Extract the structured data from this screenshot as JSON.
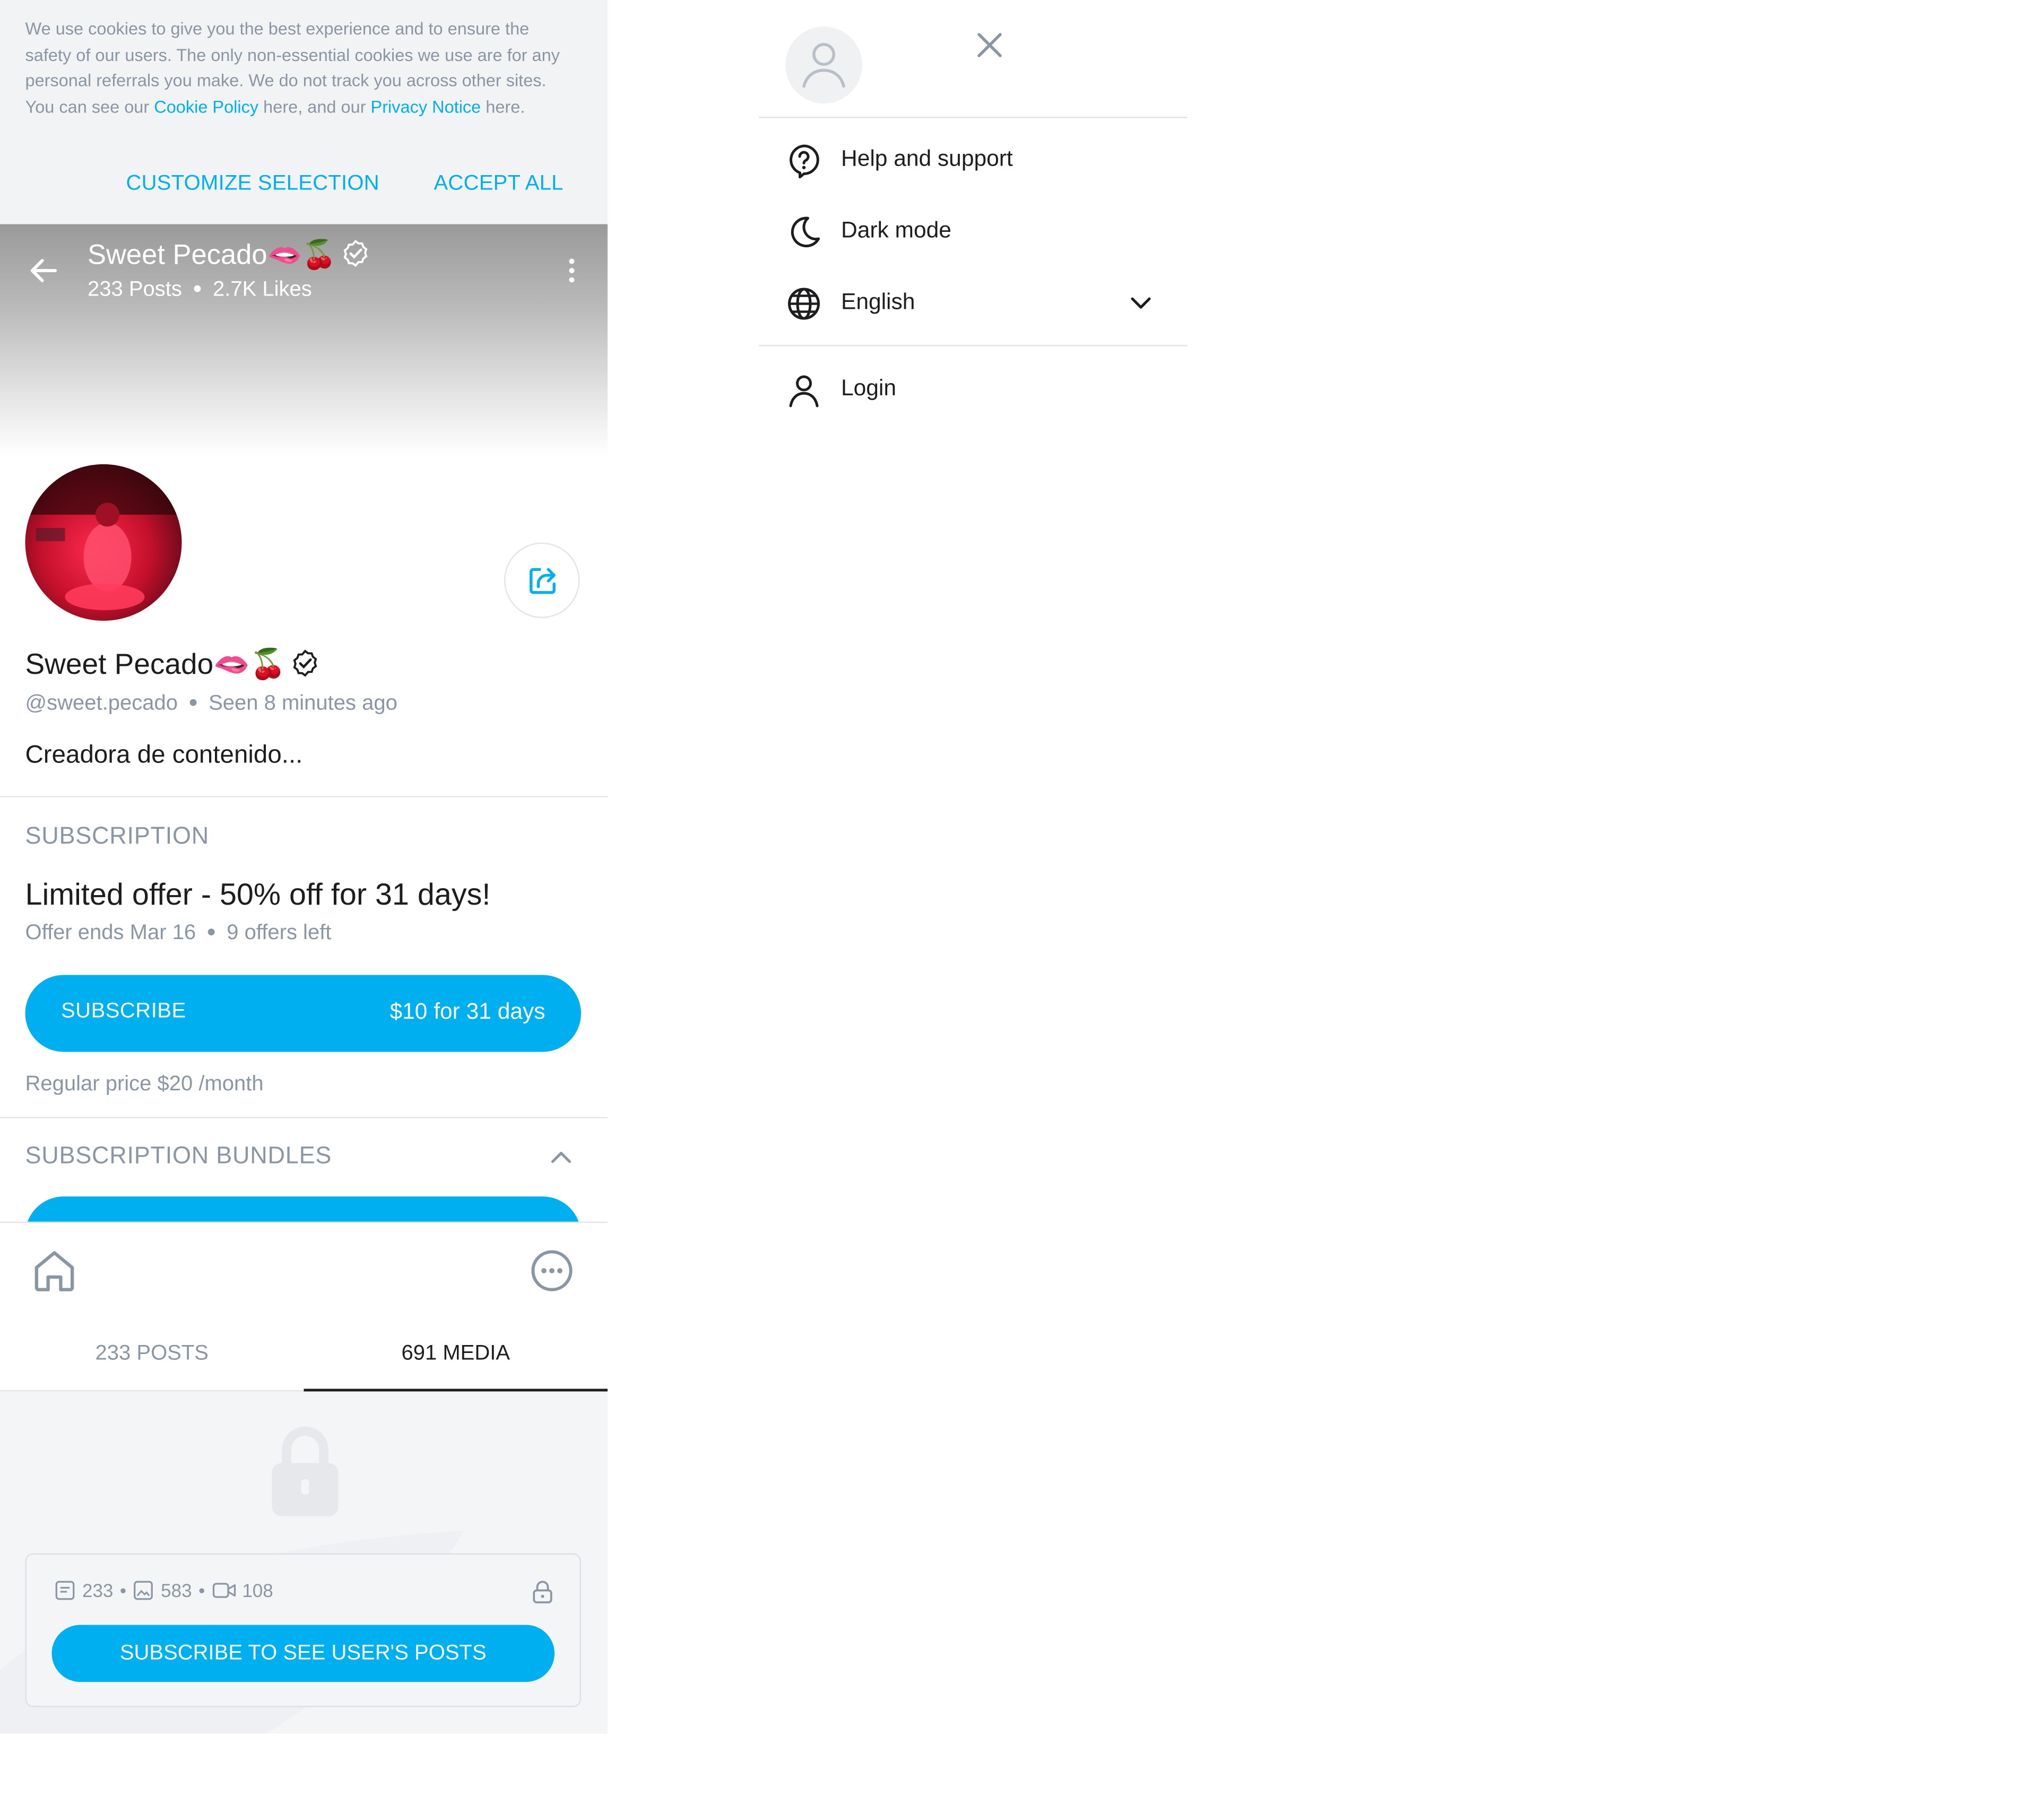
{
  "cookie": {
    "text_1": "We use cookies to give you the best experience and to ensure the safety of our users. The only non-essential cookies we use are for any personal referrals you make. We do not track you across other sites. You can see our ",
    "cookie_policy_link": "Cookie Policy",
    "text_2": " here, and our ",
    "privacy_link": "Privacy Notice",
    "text_3": " here.",
    "customize_label": "CUSTOMIZE SELECTION",
    "accept_label": "ACCEPT ALL"
  },
  "header": {
    "name": "Sweet Pecado🫦🍒",
    "posts": "233 Posts",
    "likes": "2.7K Likes"
  },
  "profile": {
    "name": "Sweet Pecado🫦🍒",
    "handle": "@sweet.pecado",
    "last_seen": "Seen 8 minutes ago",
    "bio": "Creadora de contenido..."
  },
  "subscription": {
    "section_label": "SUBSCRIPTION",
    "offer_title": "Limited offer - 50% off for 31 days!",
    "offer_ends": "Offer ends Mar 16",
    "offers_left": "9 offers left",
    "button_label": "SUBSCRIBE",
    "button_price": "$10 for 31 days",
    "regular_price": "Regular price $20 /month",
    "bundles_label": "SUBSCRIPTION BUNDLES"
  },
  "tabs": [
    {
      "label": "233 POSTS"
    },
    {
      "label": "691 MEDIA"
    }
  ],
  "locked": {
    "posts_count": "233",
    "photos_count": "583",
    "videos_count": "108",
    "button_label": "SUBSCRIBE TO SEE USER'S POSTS"
  },
  "menu": {
    "items": [
      {
        "label": "Help and support",
        "icon": "help-icon"
      },
      {
        "label": "Dark mode",
        "icon": "moon-icon"
      },
      {
        "label": "English",
        "icon": "globe-icon"
      },
      {
        "label": "Login",
        "icon": "user-icon"
      }
    ]
  },
  "colors": {
    "accent": "#00aff0",
    "muted_text": "#8a96a3",
    "primary_text": "#1d1d1f"
  }
}
